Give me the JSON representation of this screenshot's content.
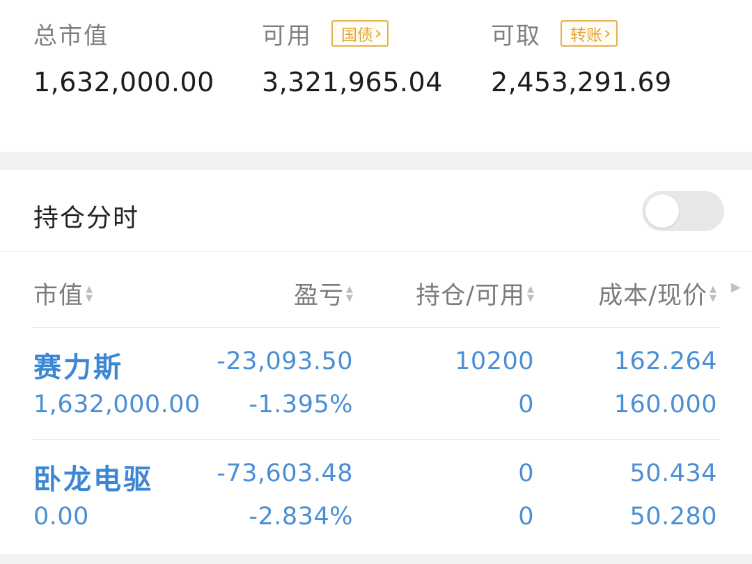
{
  "summary": {
    "total_market_value": {
      "label": "总市值",
      "value": "1,632,000.00"
    },
    "available": {
      "label": "可用",
      "value": "3,321,965.04",
      "button": "国债"
    },
    "withdrawable": {
      "label": "可取",
      "value": "2,453,291.69",
      "button": "转账"
    }
  },
  "position_timing": {
    "label": "持仓分时",
    "enabled": false
  },
  "table": {
    "headers": [
      "市值",
      "盈亏",
      "持仓/可用",
      "成本/现价"
    ],
    "rows": [
      {
        "name": "赛力斯",
        "market_value": "1,632,000.00",
        "pnl": "-23,093.50",
        "pnl_pct": "-1.395%",
        "position": "10200",
        "available": "0",
        "cost": "162.264",
        "price": "160.000"
      },
      {
        "name": "卧龙电驱",
        "market_value": "0.00",
        "pnl": "-73,603.48",
        "pnl_pct": "-2.834%",
        "position": "0",
        "available": "0",
        "cost": "50.434",
        "price": "50.280"
      }
    ]
  },
  "colors": {
    "accent_blue": "#4a8fd6",
    "tag_orange": "#e0a334",
    "label_gray": "#7f7f7f"
  }
}
